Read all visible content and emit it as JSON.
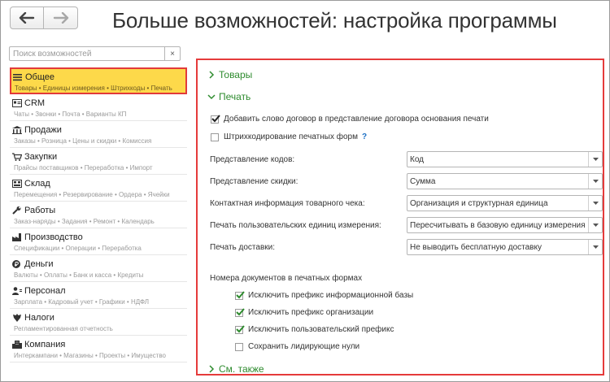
{
  "header": {
    "title": "Больше возможностей: настройка программы",
    "back_icon": "arrow-left-icon",
    "forward_icon": "arrow-right-icon"
  },
  "search": {
    "placeholder": "Поиск возможностей",
    "clear_label": "×"
  },
  "sidebar": {
    "items": [
      {
        "title": "Общее",
        "sub": "Товары • Единицы измерения • Штрихкоды • Печать",
        "icon": "menu-lines-icon",
        "active": true
      },
      {
        "title": "CRM",
        "sub": "Чаты • Звонки • Почта • Варианты КП",
        "icon": "crm-card-icon"
      },
      {
        "title": "Продажи",
        "sub": "Заказы • Розница • Цены и скидки • Комиссия",
        "icon": "store-icon"
      },
      {
        "title": "Закупки",
        "sub": "Прайсы поставщиков • Переработка • Импорт",
        "icon": "cart-icon"
      },
      {
        "title": "Склад",
        "sub": "Перемещения • Резервирование • Ордера • Ячейки",
        "icon": "warehouse-icon"
      },
      {
        "title": "Работы",
        "sub": "Заказ-наряды • Задания • Ремонт • Календарь",
        "icon": "wrench-icon"
      },
      {
        "title": "Производство",
        "sub": "Спецификации • Операции • Переработка",
        "icon": "factory-icon"
      },
      {
        "title": "Деньги",
        "sub": "Валюты • Оплаты • Банк и касса • Кредиты",
        "icon": "ruble-coin-icon"
      },
      {
        "title": "Персонал",
        "sub": "Зарплата • Кадровый учет • Графики • НДФЛ",
        "icon": "person-icon"
      },
      {
        "title": "Налоги",
        "sub": "Регламентированная отчетность",
        "icon": "emblem-icon"
      },
      {
        "title": "Компания",
        "sub": "Интеркампани • Магазины • Проекты • Имущество",
        "icon": "company-icon"
      }
    ]
  },
  "content": {
    "groups": {
      "goods": "Товары",
      "print": "Печать",
      "see_also": "См. также"
    },
    "checkboxes": [
      {
        "label": "Добавить слово договор в представление договора основания печати",
        "checked": true
      },
      {
        "label": "Штрихкодирование печатных форм",
        "checked": false,
        "help": "?"
      }
    ],
    "fields": [
      {
        "label": "Представление кодов:",
        "value": "Код"
      },
      {
        "label": "Представление скидки:",
        "value": "Сумма"
      },
      {
        "label": "Контактная информация товарного чека:",
        "value": "Организация и структурная единица"
      },
      {
        "label": "Печать пользовательских единиц измерения:",
        "value": "Пересчитывать в базовую единицу измерения"
      },
      {
        "label": "Печать доставки:",
        "value": "Не выводить бесплатную доставку"
      }
    ],
    "doc_numbers": {
      "title": "Номера документов в печатных формах",
      "options": [
        {
          "label": "Исключить префикс информационной базы",
          "checked": true
        },
        {
          "label": "Исключить префикс организации",
          "checked": true
        },
        {
          "label": "Исключить пользовательский префикс",
          "checked": true
        },
        {
          "label": "Сохранить лидирующие нули",
          "checked": false
        }
      ]
    }
  },
  "colors": {
    "accent_green": "#2e8b2e",
    "highlight_red": "#e53b3b",
    "active_yellow": "#fdd94a"
  }
}
